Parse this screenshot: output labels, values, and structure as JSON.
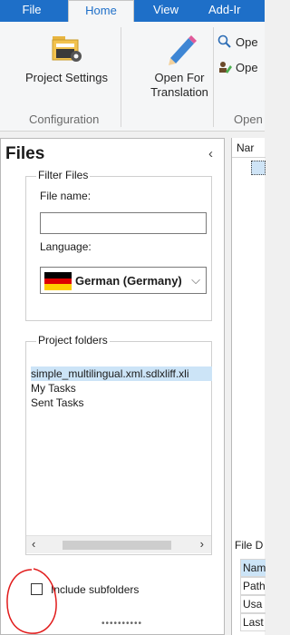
{
  "ribbon": {
    "tabs": [
      {
        "label": "File"
      },
      {
        "label": "Home"
      },
      {
        "label": "View"
      },
      {
        "label": "Add-Ir"
      }
    ],
    "buttons": {
      "project_settings": "Project Settings",
      "open_for_translation": "Open For Translation",
      "open_small_1": "Ope",
      "open_small_2": "Ope"
    },
    "groups": {
      "configuration": "Configuration",
      "open": "Open"
    }
  },
  "files_pane": {
    "title": "Files",
    "collapse_glyph": "‹",
    "filter_legend": "Filter Files",
    "file_name_label": "File name:",
    "file_name_value": "",
    "language_label": "Language:",
    "language_value": "German (Germany)",
    "project_folders_legend": "Project folders",
    "folders": [
      {
        "label": "simple_multilingual.xml.sdlxliff.xli",
        "selected": true
      },
      {
        "label": "My Tasks",
        "selected": false
      },
      {
        "label": "Sent Tasks",
        "selected": false
      }
    ],
    "include_subfolders_label": "Include subfolders",
    "include_subfolders_checked": false
  },
  "right_pane": {
    "header": "Nar",
    "details_title": "File D",
    "detail_rows": [
      {
        "label": "Nam",
        "selected": true
      },
      {
        "label": "Path",
        "selected": false
      },
      {
        "label": "Usa",
        "selected": false
      },
      {
        "label": "Last",
        "selected": false
      }
    ]
  },
  "colors": {
    "ribbon_blue": "#1e6fc8",
    "selection": "#cce4f7",
    "annotation_red": "#e11b1b"
  }
}
